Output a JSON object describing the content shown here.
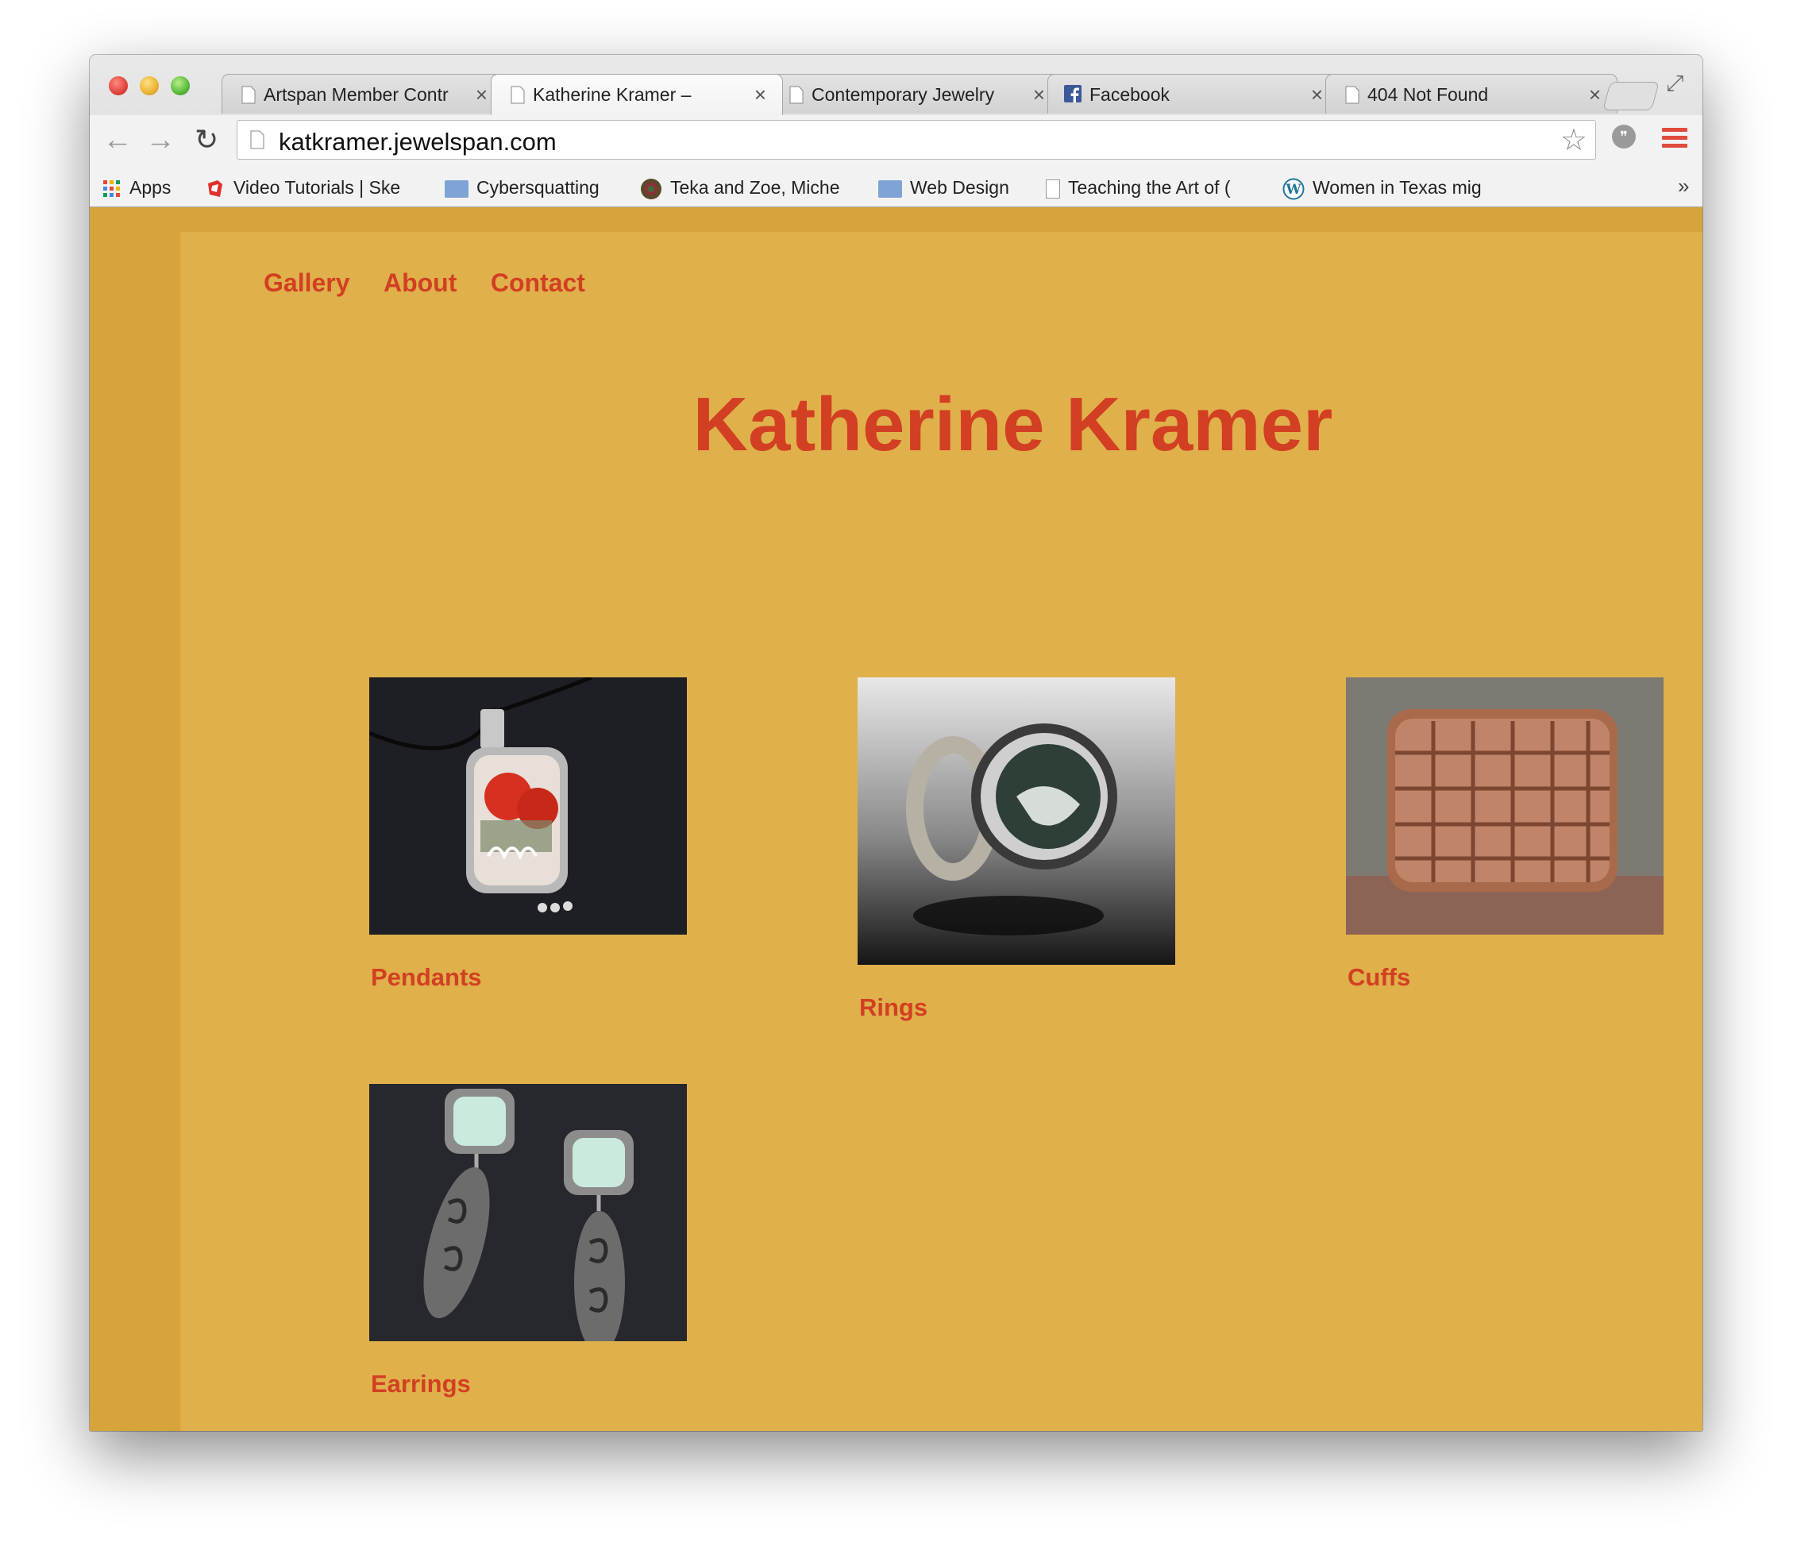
{
  "browser": {
    "tabs": [
      {
        "title": "Artspan Member Contr",
        "active": false
      },
      {
        "title": "Katherine Kramer –",
        "active": true
      },
      {
        "title": "Contemporary Jewelry",
        "active": false
      },
      {
        "title": "Facebook",
        "active": false
      },
      {
        "title": "404 Not Found",
        "active": false
      }
    ],
    "url": "katkramer.jewelspan.com",
    "bookmarks": [
      {
        "label": "Apps",
        "icon": "apps-grid-icon"
      },
      {
        "label": "Video Tutorials | Ske",
        "icon": "sketchup-icon"
      },
      {
        "label": "Cybersquatting",
        "icon": "folder-icon"
      },
      {
        "label": "Teka and Zoe, Miche",
        "icon": "avatar-icon"
      },
      {
        "label": "Web Design",
        "icon": "folder-icon"
      },
      {
        "label": "Teaching the Art of (",
        "icon": "page-icon"
      },
      {
        "label": "Women in Texas mig",
        "icon": "wordpress-icon"
      }
    ],
    "more_symbol": "»",
    "close_symbol": "×"
  },
  "site": {
    "nav": [
      "Gallery",
      "About",
      "Contact"
    ],
    "title": "Katherine Kramer",
    "gallery": [
      {
        "label": "Pendants"
      },
      {
        "label": "Rings"
      },
      {
        "label": "Cuffs"
      },
      {
        "label": "Earrings"
      }
    ]
  },
  "colors": {
    "accent": "#d23f22",
    "page_background": "#d6a43a",
    "content_background": "#e0b04a"
  }
}
